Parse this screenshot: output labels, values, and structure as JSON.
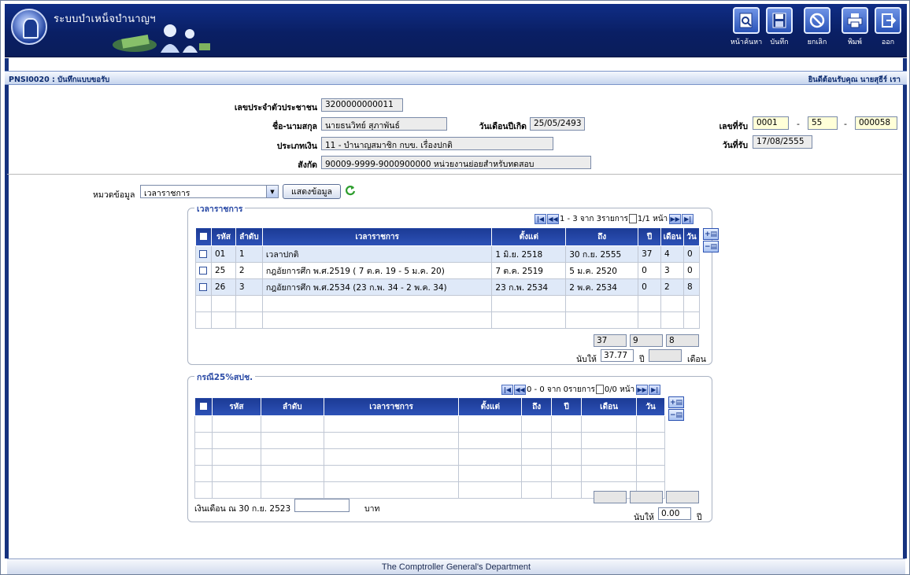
{
  "app": {
    "title": "ระบบบำเหน็จบำนาญฯ",
    "screen_code": "PNSI0020 : บันทึกแบบขอรับ",
    "welcome": "ยินดีต้อนรับคุณ นายสุธีร์ เรา"
  },
  "toolbar": {
    "search_label": "หน้าค้นหา",
    "save_label": "บันทึก",
    "cancel_label": "ยกเลิก",
    "print_label": "พิมพ์",
    "exit_label": "ออก"
  },
  "form": {
    "id_label": "เลขประจำตัวประชาชน",
    "id_value": "3200000000011",
    "name_label": "ชื่อ-นามสกุล",
    "name_value": "นายธนวิทย์ สุภาพันธ์",
    "birth_label": "วันเดือนปีเกิด",
    "birth_value": "25/05/2493",
    "paytype_label": "ประเภทเงิน",
    "paytype_value": "11 - บำนาญสมาชิก กบข. เรื่องปกติ",
    "agency_label": "สังกัด",
    "agency_value": "90009-9999-9000900000  หน่วยงานย่อยสำหรับทดสอบ",
    "recv_no_label": "เลขที่รับ",
    "recv_no_1": "0001",
    "recv_no_dash1": "-",
    "recv_no_2": "55",
    "recv_no_dash2": "-",
    "recv_no_3": "000058",
    "recv_date_label": "วันที่รับ",
    "recv_date_value": "17/08/2555"
  },
  "category": {
    "label": "หมวดข้อมูล",
    "selected": "เวลาราชการ",
    "show_button": "แสดงข้อมูล"
  },
  "service": {
    "caption": "เวลาราชการ",
    "pager_text": "1 - 3 จาก 3รายการ",
    "pager_page": "1/1 หน้า",
    "columns": [
      "รหัส",
      "ลำดับ",
      "เวลาราชการ",
      "ตั้งแต่",
      "ถึง",
      "ปี",
      "เดือน",
      "วัน"
    ],
    "rows": [
      [
        "01",
        "1",
        "เวลาปกติ",
        "1 มิ.ย. 2518",
        "30 ก.ย. 2555",
        "37",
        "4",
        "0"
      ],
      [
        "25",
        "2",
        "กฎอัยการศึก พ.ศ.2519 ( 7 ต.ค. 19 - 5 ม.ค. 20)",
        "7 ต.ค. 2519",
        "5 ม.ค. 2520",
        "0",
        "3",
        "0"
      ],
      [
        "26",
        "3",
        "กฎอัยการศึก พ.ศ.2534 (23 ก.พ. 34 - 2 พ.ค. 34)",
        "23 ก.พ. 2534",
        "2 พ.ค. 2534",
        "0",
        "2",
        "8"
      ]
    ],
    "sum_year": "37",
    "sum_month": "9",
    "sum_day": "8",
    "count_label": "นับให้",
    "count_value": "37.77",
    "year_label": "ปี",
    "count_month": "",
    "month_label": "เดือน"
  },
  "case25": {
    "caption": "กรณี25%สปช.",
    "pager_text": "0 - 0 จาก 0รายการ",
    "pager_page": "0/0 หน้า",
    "columns": [
      "รหัส",
      "ลำดับ",
      "เวลาราชการ",
      "ตั้งแต่",
      "ถึง",
      "ปี",
      "เดือน",
      "วัน"
    ],
    "salary_label": "เงินเดือน ณ 30 ก.ย. 2523",
    "salary_value": "",
    "baht_label": "บาท",
    "count_label": "นับให้",
    "count_value": "0.00",
    "year_label": "ปี"
  },
  "footer": {
    "text": "The Comptroller General's Department"
  }
}
